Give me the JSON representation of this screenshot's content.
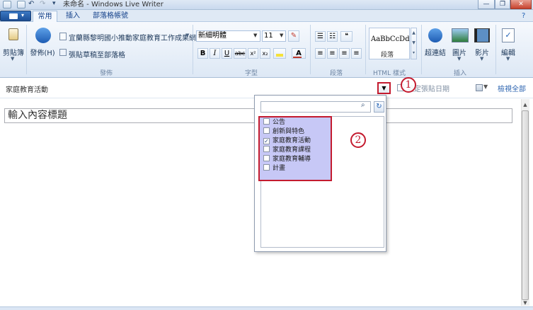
{
  "window": {
    "title": "未命名 - Windows Live Writer",
    "minimize": "—",
    "restore": "❐",
    "close": "✕"
  },
  "tabs": [
    {
      "label": "常用"
    },
    {
      "label": "插入"
    },
    {
      "label": "部落格帳號"
    }
  ],
  "ribbon": {
    "clipboard_label": "剪貼簿",
    "publish_label": "發佈(H)",
    "blog_name": "宜蘭縣黎明國小推動家庭教育工作成果網",
    "save_draft_label": "張貼草稿至部落格",
    "font_name": "新細明體",
    "font_size": "11",
    "bold": "B",
    "italic": "I",
    "underline": "U",
    "strikethrough": "abc",
    "superscript": "x²",
    "style_preview": "AaBbCcDd",
    "style_name": "段落",
    "link_label": "超連結",
    "picture_label": "圖片",
    "video_label": "影片",
    "edit_label": "編輯",
    "groups": {
      "publish": "發佈",
      "font": "字型",
      "paragraph": "段落",
      "html_style": "HTML 樣式",
      "insert": "插入"
    }
  },
  "category_bar": {
    "selected_text": "家庭教育活動",
    "date_placeholder": "設定張貼日期",
    "view_all": "檢視全部"
  },
  "editor": {
    "title_placeholder": "輸入內容標題"
  },
  "popup": {
    "search_value": "",
    "categories": [
      {
        "label": "公告",
        "checked": false,
        "mark": ""
      },
      {
        "label": "創新與特色",
        "checked": false,
        "mark": ""
      },
      {
        "label": "家庭教育活動",
        "checked": true,
        "mark": "✓"
      },
      {
        "label": "家庭教育課程",
        "checked": false,
        "mark": ""
      },
      {
        "label": "家庭教育輔導",
        "checked": false,
        "mark": ""
      },
      {
        "label": "計畫",
        "checked": false,
        "mark": ""
      }
    ]
  },
  "annotations": [
    "1",
    "2"
  ],
  "colors": {
    "annotation": "#c41b2f",
    "highlight": "#c7c8f6",
    "ribbon_bg": "#dde8f5"
  }
}
